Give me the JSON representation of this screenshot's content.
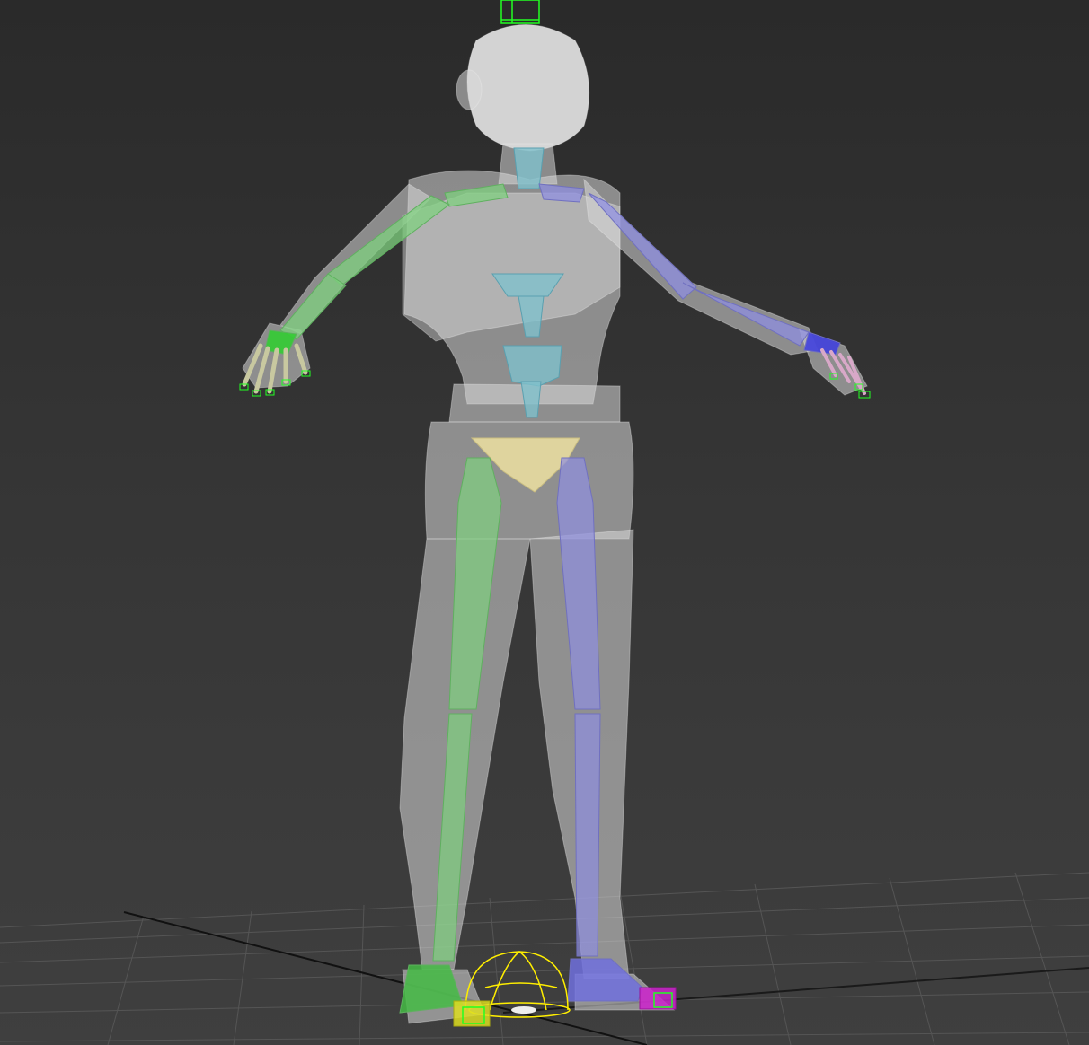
{
  "viewport": {
    "background_top": "#2a2a2a",
    "background_bottom": "#3f3f3f",
    "grid_color": "#5a5a5a",
    "grid_axis_color": "#111111"
  },
  "rig": {
    "mesh_color": "#d4d4d4",
    "left_side_bone_color": "#7fd07f",
    "right_side_bone_color": "#8f8fe0",
    "spine_bone_color": "#7fc0cc",
    "pelvis_bone_color": "#e8dca0",
    "selection_color": "#22ff22",
    "root_helper_color": "#ffee00",
    "left_foot_handle_color": "#dddd22",
    "right_foot_handle_color": "#cc22cc"
  },
  "icons": {
    "root_helper": "bounding-dome-icon",
    "head_handle": "box-gizmo-icon"
  }
}
